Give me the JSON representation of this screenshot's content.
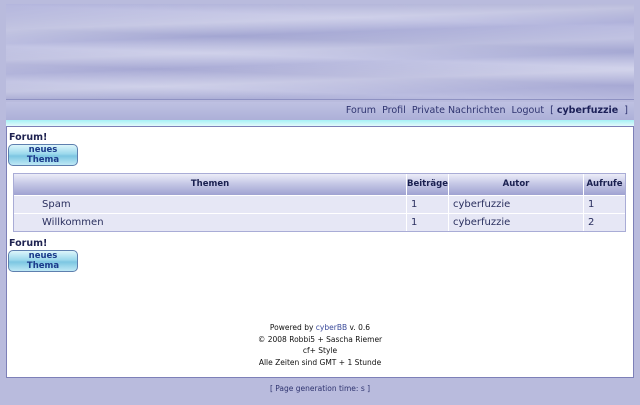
{
  "navbar": {
    "items": [
      "Forum",
      "Profil",
      "Private Nachrichten",
      "Logout"
    ],
    "open_bracket": "[",
    "username": "cyberfuzzie",
    "close_bracket": "]"
  },
  "content": {
    "forum_label": "Forum!",
    "new_topic_line1": "neues",
    "new_topic_line2": "Thema",
    "table": {
      "headers": [
        "Themen",
        "Beiträge",
        "Autor",
        "Aufrufe"
      ],
      "rows": [
        {
          "topic": "Spam",
          "posts": "1",
          "author": "cyberfuzzie",
          "views": "1"
        },
        {
          "topic": "Willkommen",
          "posts": "1",
          "author": "cyberfuzzie",
          "views": "2"
        }
      ]
    },
    "footer": {
      "powered_prefix": "Powered by",
      "powered_brand": "cyberBB",
      "powered_version": "v. 0.6",
      "copyright": "© 2008 Robbi5 + Sascha Riemer",
      "style": "cf+ Style",
      "timezone": "Alle Zeiten sind GMT + 1 Stunde"
    }
  },
  "page_generation": "[ Page generation time: s ]"
}
